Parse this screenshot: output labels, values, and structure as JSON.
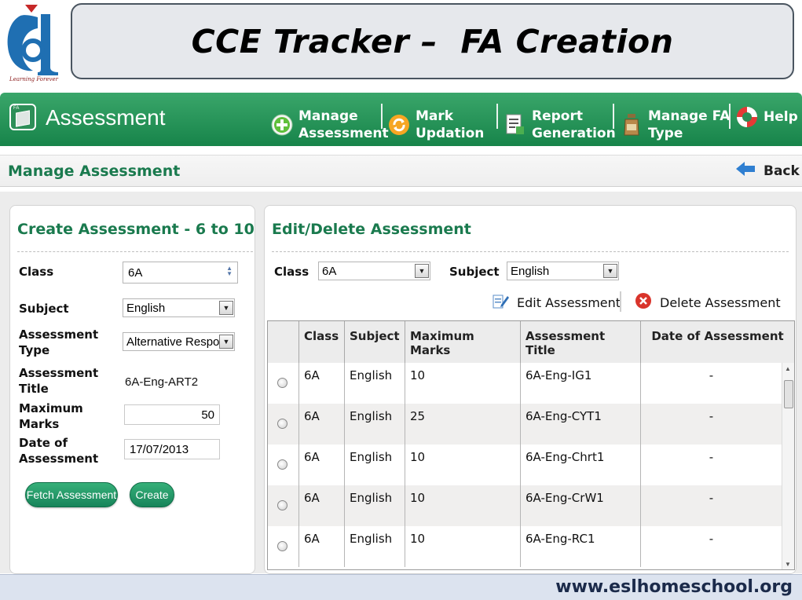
{
  "banner": {
    "logo_tagline": "Learning Forever",
    "title": "CCE Tracker –  FA Creation"
  },
  "nav": {
    "app_name": "Assessment",
    "items": [
      {
        "label": "Manage\nAssessment",
        "icon": "plus-circle-icon"
      },
      {
        "label": "Mark\nUpdation",
        "icon": "refresh-icon"
      },
      {
        "label": "Report\nGeneration",
        "icon": "report-icon"
      },
      {
        "label": "Manage FA\nType",
        "icon": "bottle-icon"
      },
      {
        "label": "Help",
        "icon": "lifebuoy-icon"
      }
    ]
  },
  "subheader": {
    "title": "Manage Assessment",
    "back_label": "Back"
  },
  "create_panel": {
    "title": "Create Assessment - 6 to 10",
    "class_label": "Class",
    "class_value": "6A",
    "subject_label": "Subject",
    "subject_value": "English",
    "type_label": "Assessment\nType",
    "type_value": "Alternative Respor",
    "title_label": "Assessment\nTitle",
    "title_value": "6A-Eng-ART2",
    "max_marks_label": "Maximum\nMarks",
    "max_marks_value": "50",
    "date_label": "Date of\nAssessment",
    "date_value": "17/07/2013",
    "fetch_button": "Fetch Assessment",
    "create_button": "Create"
  },
  "edit_panel": {
    "title": "Edit/Delete Assessment",
    "class_label": "Class",
    "class_value": "6A",
    "subject_label": "Subject",
    "subject_value": "English",
    "edit_button": "Edit Assessment",
    "delete_button": "Delete Assessment",
    "columns": [
      "Class",
      "Subject",
      "Maximum Marks",
      "Assessment Title",
      "Date of Assessment"
    ],
    "rows": [
      {
        "class": "6A",
        "subject": "English",
        "max_marks": "10",
        "title": "6A-Eng-IG1",
        "date": "-"
      },
      {
        "class": "6A",
        "subject": "English",
        "max_marks": "25",
        "title": "6A-Eng-CYT1",
        "date": "-"
      },
      {
        "class": "6A",
        "subject": "English",
        "max_marks": "10",
        "title": "6A-Eng-Chrt1",
        "date": "-"
      },
      {
        "class": "6A",
        "subject": "English",
        "max_marks": "10",
        "title": "6A-Eng-CrW1",
        "date": "-"
      },
      {
        "class": "6A",
        "subject": "English",
        "max_marks": "10",
        "title": "6A-Eng-RC1",
        "date": "-"
      }
    ]
  },
  "footer": {
    "url": "www.eslhomeschool.org"
  },
  "colors": {
    "nav_green": "#17844a",
    "title_green": "#1a7a4e",
    "delete_red": "#d9342b"
  }
}
